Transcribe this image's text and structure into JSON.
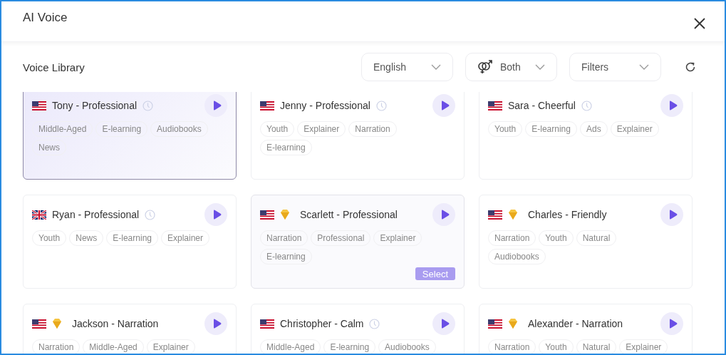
{
  "window": {
    "title": "AI Voice"
  },
  "toolbar": {
    "title": "Voice Library",
    "language": "English",
    "gender": "Both",
    "filters": "Filters"
  },
  "voices": [
    {
      "name": "Tony - Professional",
      "kind": "us",
      "premium": false,
      "recent": true,
      "selected": true,
      "tag_rows": [
        [
          "Middle-Aged",
          "E-learning",
          "Audiobooks"
        ],
        [
          "News"
        ]
      ]
    },
    {
      "name": "Jenny - Professional",
      "kind": "us",
      "premium": false,
      "recent": true,
      "selected": false,
      "tag_rows": [
        [
          "Youth",
          "Explainer",
          "Narration"
        ],
        [
          "E-learning"
        ]
      ]
    },
    {
      "name": "Sara - Cheerful",
      "kind": "us",
      "premium": false,
      "recent": true,
      "selected": false,
      "tag_rows": [
        [
          "Youth",
          "E-learning",
          "Ads",
          "Explainer"
        ]
      ]
    },
    {
      "name": "Ryan - Professional",
      "kind": "uk",
      "premium": false,
      "recent": true,
      "selected": false,
      "tag_rows": [
        [
          "Youth",
          "News",
          "E-learning",
          "Explainer"
        ]
      ]
    },
    {
      "name": "Scarlett - Professional",
      "kind": "us",
      "premium": true,
      "recent": false,
      "selected": false,
      "select_button": "Select",
      "tag_rows": [
        [
          "Narration",
          "Professional",
          "Explainer"
        ],
        [
          "E-learning"
        ]
      ]
    },
    {
      "name": "Charles - Friendly",
      "kind": "us",
      "premium": true,
      "recent": false,
      "selected": false,
      "tag_rows": [
        [
          "Narration",
          "Youth",
          "Natural"
        ],
        [
          "Audiobooks"
        ]
      ]
    },
    {
      "name": "Jackson - Narration",
      "kind": "us",
      "premium": true,
      "recent": false,
      "selected": false,
      "tag_rows": [
        [
          "Narration",
          "Middle-Aged",
          "Explainer"
        ]
      ]
    },
    {
      "name": "Christopher - Calm",
      "kind": "us",
      "premium": false,
      "recent": true,
      "selected": false,
      "tag_rows": [
        [
          "Middle-Aged",
          "E-learning",
          "Audiobooks"
        ]
      ]
    },
    {
      "name": "Alexander - Narration",
      "kind": "us",
      "premium": true,
      "recent": false,
      "selected": false,
      "tag_rows": [
        [
          "Narration",
          "Youth",
          "Natural",
          "Explainer"
        ]
      ]
    }
  ]
}
